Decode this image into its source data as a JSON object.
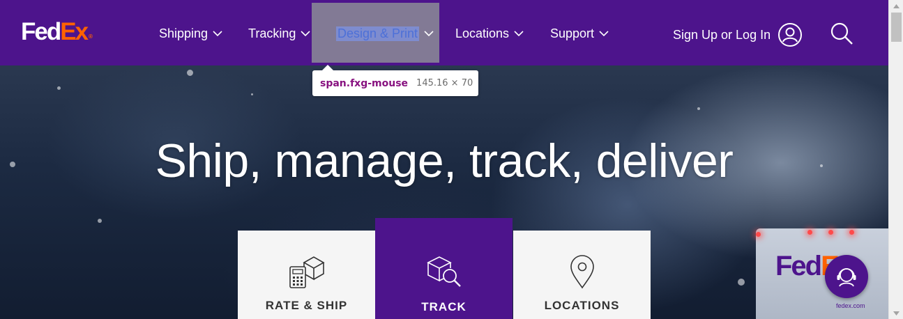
{
  "header": {
    "logo": {
      "fed": "Fed",
      "ex": "Ex",
      "reg": "®"
    },
    "nav": [
      {
        "label": "Shipping"
      },
      {
        "label": "Tracking"
      },
      {
        "label": "Design & Print"
      },
      {
        "label": "Locations"
      },
      {
        "label": "Support"
      }
    ],
    "signin_label": "Sign Up or Log In",
    "colors": {
      "brand_purple": "#4d148c",
      "brand_orange": "#ff6200"
    }
  },
  "inspector_tooltip": {
    "selector": "span.fxg-mouse",
    "dimensions": "145.16 × 70"
  },
  "hero": {
    "title": "Ship, manage, track, deliver",
    "cards": [
      {
        "label": "RATE & SHIP",
        "icon": "rate-ship-icon"
      },
      {
        "label": "TRACK",
        "icon": "track-package-icon"
      },
      {
        "label": "LOCATIONS",
        "icon": "location-pin-icon"
      }
    ],
    "truck": {
      "brand_fed": "Fed",
      "brand_ex": "Ex",
      "url": "fedex.com"
    }
  }
}
